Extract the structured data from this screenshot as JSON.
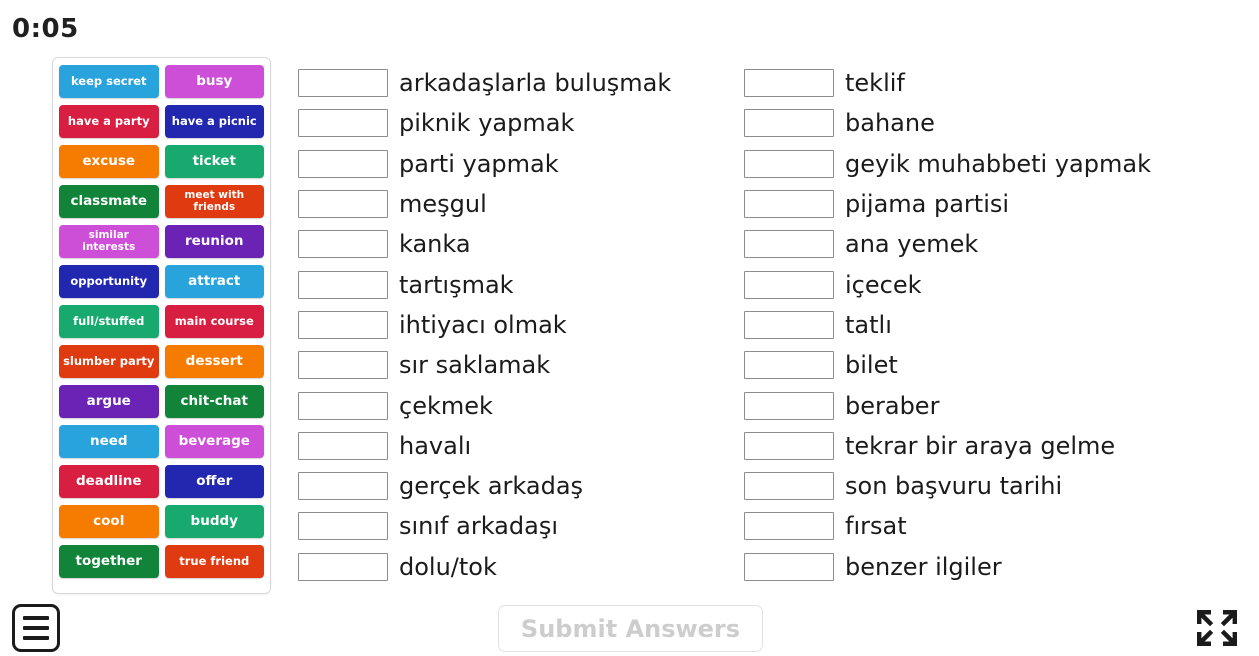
{
  "timer": {
    "value": "0:05"
  },
  "word_bank": {
    "tiles": [
      {
        "label": "keep secret",
        "color": "#29a3dc"
      },
      {
        "label": "busy",
        "color": "#cd4fd8"
      },
      {
        "label": "have a party",
        "color": "#d81e41"
      },
      {
        "label": "have a picnic",
        "color": "#2227b0"
      },
      {
        "label": "excuse",
        "color": "#f57c00"
      },
      {
        "label": "ticket",
        "color": "#17a96e"
      },
      {
        "label": "classmate",
        "color": "#11843a"
      },
      {
        "label": "meet with friends",
        "color": "#e03a10"
      },
      {
        "label": "similar interests",
        "color": "#cd4fd8"
      },
      {
        "label": "reunion",
        "color": "#6a23b5"
      },
      {
        "label": "opportunity",
        "color": "#2227b0"
      },
      {
        "label": "attract",
        "color": "#29a3dc"
      },
      {
        "label": "full/stuffed",
        "color": "#17a96e"
      },
      {
        "label": "main course",
        "color": "#d81e41"
      },
      {
        "label": "slumber party",
        "color": "#e03a10"
      },
      {
        "label": "dessert",
        "color": "#f57c00"
      },
      {
        "label": "argue",
        "color": "#6a23b5"
      },
      {
        "label": "chit-chat",
        "color": "#11843a"
      },
      {
        "label": "need",
        "color": "#29a3dc"
      },
      {
        "label": "beverage",
        "color": "#cd4fd8"
      },
      {
        "label": "deadline",
        "color": "#d81e41"
      },
      {
        "label": "offer",
        "color": "#2227b0"
      },
      {
        "label": "cool",
        "color": "#f57c00"
      },
      {
        "label": "buddy",
        "color": "#17a96e"
      },
      {
        "label": "together",
        "color": "#11843a"
      },
      {
        "label": "true friend",
        "color": "#e03a10"
      }
    ]
  },
  "answers": {
    "column_1": [
      {
        "value": "",
        "label": "arkadaşlarla buluşmak"
      },
      {
        "value": "",
        "label": "piknik yapmak"
      },
      {
        "value": "",
        "label": "parti yapmak"
      },
      {
        "value": "",
        "label": "meşgul"
      },
      {
        "value": "",
        "label": "kanka"
      },
      {
        "value": "",
        "label": "tartışmak"
      },
      {
        "value": "",
        "label": "ihtiyacı olmak"
      },
      {
        "value": "",
        "label": "sır saklamak"
      },
      {
        "value": "",
        "label": "çekmek"
      },
      {
        "value": "",
        "label": "havalı"
      },
      {
        "value": "",
        "label": "gerçek arkadaş"
      },
      {
        "value": "",
        "label": "sınıf arkadaşı"
      },
      {
        "value": "",
        "label": "dolu/tok"
      }
    ],
    "column_2": [
      {
        "value": "",
        "label": "teklif"
      },
      {
        "value": "",
        "label": "bahane"
      },
      {
        "value": "",
        "label": "geyik muhabbeti yapmak"
      },
      {
        "value": "",
        "label": "pijama partisi"
      },
      {
        "value": "",
        "label": "ana yemek"
      },
      {
        "value": "",
        "label": "içecek"
      },
      {
        "value": "",
        "label": "tatlı"
      },
      {
        "value": "",
        "label": "bilet"
      },
      {
        "value": "",
        "label": "beraber"
      },
      {
        "value": "",
        "label": "tekrar bir araya gelme"
      },
      {
        "value": "",
        "label": "son başvuru tarihi"
      },
      {
        "value": "",
        "label": "fırsat"
      },
      {
        "value": "",
        "label": "benzer ilgiler"
      }
    ]
  },
  "bottom_bar": {
    "menu_icon": "hamburger-menu-icon",
    "submit_label": "Submit Answers",
    "submit_enabled": false,
    "fullscreen_icon": "fullscreen-expand-icon"
  },
  "colors": {
    "text": "#1b1b1b",
    "input_border": "#8d8d8d",
    "submit_text_disabled": "#cdcdcd",
    "panel_border": "#d8d8d8"
  }
}
